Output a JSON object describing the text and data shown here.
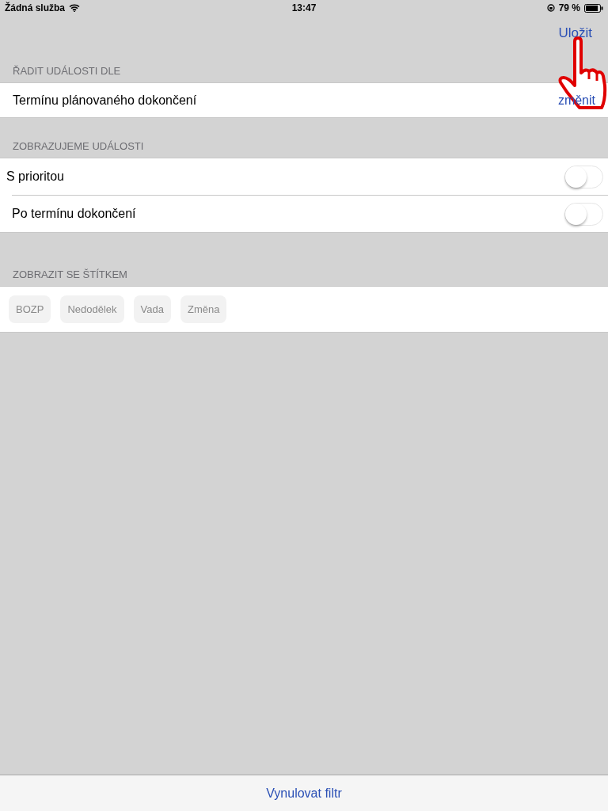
{
  "status_bar": {
    "carrier": "Žádná služba",
    "time": "13:47",
    "battery": "79 %"
  },
  "nav": {
    "save": "Uložit"
  },
  "sort": {
    "header": "ŘADIT UDÁLOSTI DLE",
    "value": "Termínu plánovaného dokončení",
    "action": "změnit"
  },
  "filters": {
    "header": "ZOBRAZUJEME UDÁLOSTI",
    "items": [
      {
        "label": "S prioritou",
        "on": false
      },
      {
        "label": "Po termínu dokončení",
        "on": false
      }
    ]
  },
  "tags": {
    "header": "ZOBRAZIT SE ŠTÍTKEM",
    "items": [
      {
        "label": "BOZP",
        "selected": false
      },
      {
        "label": "Nedodělek",
        "selected": false
      },
      {
        "label": "Vada",
        "selected": false
      },
      {
        "label": "Změna",
        "selected": false
      }
    ]
  },
  "footer": {
    "reset": "Vynulovat filtr"
  }
}
